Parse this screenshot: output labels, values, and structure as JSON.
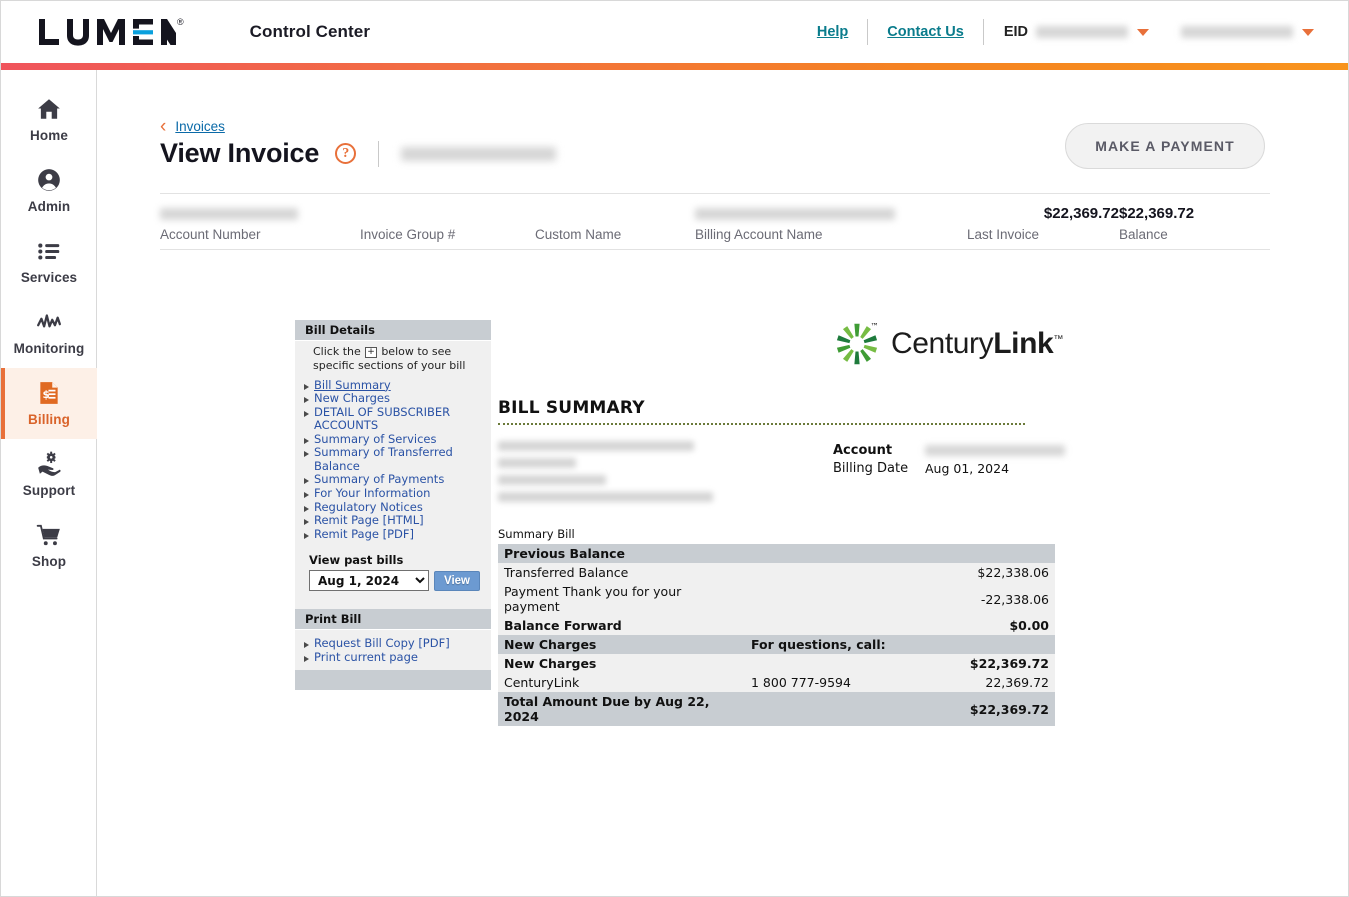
{
  "header": {
    "logo_text": "LUMEN",
    "logo_reg": "®",
    "app_title": "Control Center",
    "help_label": "Help",
    "contact_label": "Contact Us",
    "eid_label": "EID",
    "eid_value_redacted": true,
    "user_value_redacted": true
  },
  "sidebar": {
    "items": [
      {
        "label": "Home",
        "icon": "home-icon",
        "active": false
      },
      {
        "label": "Admin",
        "icon": "user-circle-icon",
        "active": false
      },
      {
        "label": "Services",
        "icon": "list-icon",
        "active": false
      },
      {
        "label": "Monitoring",
        "icon": "activity-icon",
        "active": false
      },
      {
        "label": "Billing",
        "icon": "invoice-dollar-icon",
        "active": true
      },
      {
        "label": "Support",
        "icon": "support-hand-icon",
        "active": false
      },
      {
        "label": "Shop",
        "icon": "cart-icon",
        "active": false
      }
    ]
  },
  "page": {
    "breadcrumb_label": "Invoices",
    "title": "View Invoice",
    "help_glyph": "?",
    "invoice_id_redacted": true,
    "make_payment_label": "MAKE A PAYMENT"
  },
  "account_strip": {
    "cells": [
      {
        "label": "Account Number",
        "value": "",
        "redacted": true
      },
      {
        "label": "Invoice Group #",
        "value": "",
        "redacted": false
      },
      {
        "label": "Custom Name",
        "value": "",
        "redacted": false
      },
      {
        "label": "Billing Account Name",
        "value": "",
        "redacted": true
      },
      {
        "label": "Last Invoice",
        "value": "$22,369.72",
        "redacted": false
      },
      {
        "label": "Balance",
        "value": "$22,369.72",
        "redacted": false
      }
    ]
  },
  "bill_details_panel": {
    "header": "Bill Details",
    "note_prefix": "Click the",
    "note_plus": "+",
    "note_suffix": "below to see specific sections of your bill",
    "links": [
      {
        "label": "Bill Summary",
        "current": true
      },
      {
        "label": "New Charges",
        "current": false
      },
      {
        "label": "DETAIL OF SUBSCRIBER ACCOUNTS",
        "current": false
      },
      {
        "label": "Summary of Services",
        "current": false
      },
      {
        "label": "Summary of Transferred Balance",
        "current": false
      },
      {
        "label": "Summary of Payments",
        "current": false
      },
      {
        "label": "For Your Information",
        "current": false
      },
      {
        "label": "Regulatory Notices",
        "current": false
      },
      {
        "label": "Remit Page [HTML]",
        "current": false
      },
      {
        "label": "Remit Page [PDF]",
        "current": false
      }
    ],
    "past_bills_label": "View past bills",
    "past_bills_selected": "Aug 1, 2024",
    "past_bills_options": [
      "Aug 1, 2024"
    ],
    "view_button_label": "View",
    "print_header": "Print Bill",
    "print_links": [
      {
        "label": "Request Bill Copy [PDF]"
      },
      {
        "label": "Print current page"
      }
    ]
  },
  "bill_document": {
    "brand_name_light": "Century",
    "brand_name_bold": "Link",
    "brand_tm": "™",
    "title": "BILL SUMMARY",
    "customer_address_redacted": true,
    "account_key": "Account",
    "account_value_redacted": true,
    "billing_date_key": "Billing Date",
    "billing_date_value": "Aug 01, 2024",
    "summary_caption": "Summary Bill",
    "rows": [
      {
        "type": "hdr",
        "label": "Previous Balance",
        "mid": "",
        "amount": ""
      },
      {
        "type": "data",
        "label": "Transferred Balance",
        "mid": "",
        "amount": "$22,338.06"
      },
      {
        "type": "data",
        "label": "Payment Thank you for your payment",
        "mid": "",
        "amount": "-22,338.06"
      },
      {
        "type": "bold",
        "label": "Balance Forward",
        "mid": "",
        "amount": "$0.00"
      },
      {
        "type": "hdr",
        "label": "New Charges",
        "mid": "For questions, call:",
        "amount": ""
      },
      {
        "type": "bold",
        "label": "New Charges",
        "mid": "",
        "amount": "$22,369.72"
      },
      {
        "type": "data",
        "label": "CenturyLink",
        "mid": "1 800 777-9594",
        "amount": "22,369.72"
      },
      {
        "type": "total",
        "label": "Total Amount Due by Aug 22, 2024",
        "mid": "",
        "amount": "$22,369.72"
      }
    ]
  },
  "colors": {
    "brand_orange": "#e8703a",
    "brand_teal": "#0a7c8c",
    "link_blue": "#2a52a5",
    "rule_left": "#f0545c",
    "rule_right": "#f8941d",
    "table_header_gray": "#c8cdd2",
    "table_row_gray": "#f0f0f0"
  }
}
